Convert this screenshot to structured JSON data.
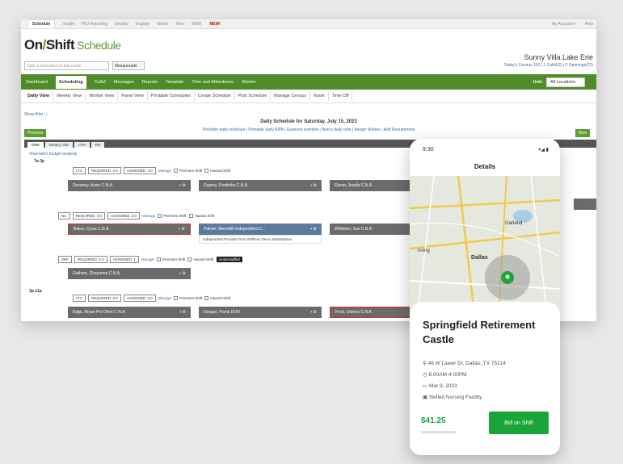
{
  "topnav": {
    "items": [
      "Schedule",
      "Insight",
      "PBJ Reporting",
      "Employ",
      "Engage",
      "Wallet",
      "Time",
      "SAMI"
    ],
    "new_badge": "NEW!",
    "account": "My Account ▾",
    "help": "Help"
  },
  "brand": {
    "logo_main": "On",
    "logo_shift": "Shift",
    "logo_product": "Schedule",
    "search_placeholder": "Type a username or last name",
    "masquerade": "Masquerade",
    "facility": "Sunny Villa Lake Erie",
    "census": "Today's Census 102 | 1 Callof(2) | 0 Openings(22)"
  },
  "mainnav": {
    "items": [
      "Dashboard",
      "Scheduling",
      "Callof",
      "Messages",
      "Reports",
      "Template",
      "Time and Attendance",
      "Worker"
    ],
    "current": "Scheduling",
    "unit_label": "Unit:",
    "unit_value": "All Locations"
  },
  "subtabs": {
    "items": [
      "Daily View",
      "Weekly View",
      "Worker View",
      "Panel View",
      "Printable Schedules",
      "Create Schedule",
      "Post Schedule",
      "Manage Census",
      "Kiosk",
      "Time Off"
    ],
    "current": "Daily View"
  },
  "schedule": {
    "filter": "Show filter",
    "title": "Daily Schedule for Saturday, July 15, 2023",
    "links": "Printable daily schedule | Printable daily BIPA | Examine overtime | Add a daily note | Assign Worker | Add Requirement",
    "prev": "Previous",
    "next": "Next",
    "tabs": [
      "CNA",
      "Dietary Aide",
      "LPN",
      "RN"
    ],
    "view_labor": "View labor budget analysis",
    "shift1": "7a-3p",
    "shift2": "3p-11p",
    "manage": "Manage",
    "premium": "Premium Shift",
    "hazard": "Hazard Shift",
    "understaffed": "Understaffed",
    "rows": [
      {
        "unit": "LTC",
        "required": "REQUIRED: 4.0",
        "assigned": "ASSIGNED: 4.0"
      },
      {
        "unit": "NC",
        "required": "REQUIRED: 3.0",
        "assigned": "ASSIGNED: 3.0"
      },
      {
        "unit": "SNF",
        "required": "REQUIRED: 2.0",
        "assigned": "ASSIGNED: 1"
      },
      {
        "unit": "LTC",
        "required": "REQUIRED: 3.0",
        "assigned": "ASSIGNED: 3.0"
      }
    ],
    "workers": {
      "w1": "Devaney, Azzie C.N.A.",
      "w2": "Duprey, Fredricka C.N.A.",
      "w3": "Elsner, Josefa C.N.A.",
      "w4": "Baker, Cyrus C.N.A.",
      "w5": "Palmer, Meredith Independent C...",
      "w5_sub": "Independent Provider from ShiftKey Demo Marketplace",
      "w6": "Whitman, Sue C.N.A.",
      "w7": "Gethers, Cheyenne C.N.A.",
      "w8": "Edge, Bryan Per Diem C.N.A.",
      "w9": "Grogan, Frank DON",
      "w10": "Peck, Glenna C.N.A."
    }
  },
  "phone": {
    "time": "9:30",
    "status": "▾◢ ▮",
    "header": "Details",
    "map_labels": [
      "Garland",
      "Irving",
      "Dallas"
    ],
    "facility_name": "Springfield Retirement Castle",
    "address": "48 W Lawer Dr, Dallas, TX 75214",
    "hours": "8:00AM-4:00PM",
    "date": "Mar 9, 2023",
    "type": "Skilled Nursing Facility",
    "rate": "$41.25",
    "bid": "Bid on Shift"
  }
}
